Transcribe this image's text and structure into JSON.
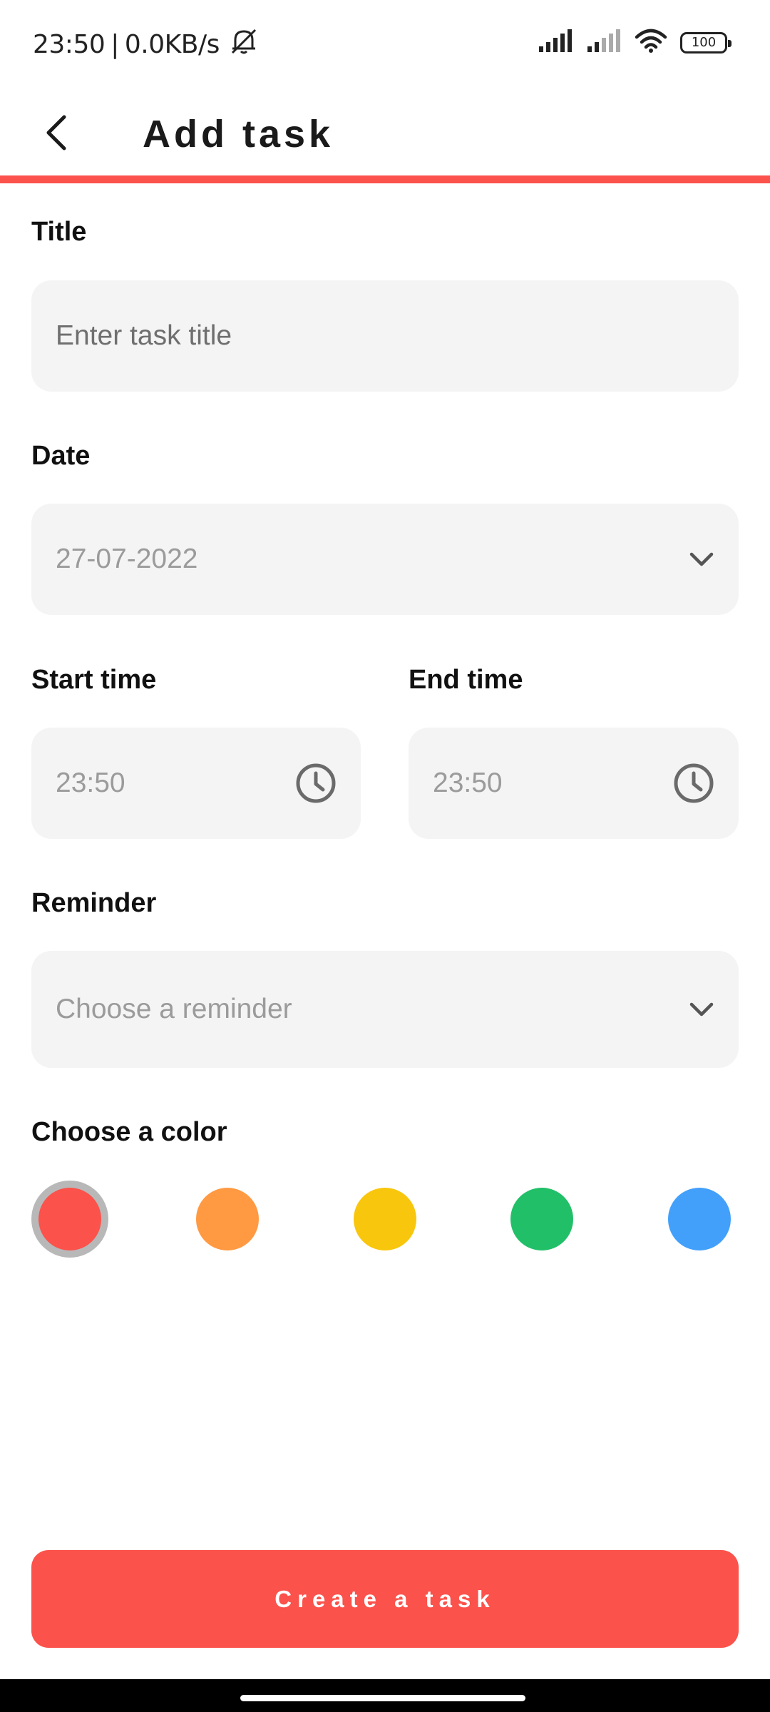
{
  "status_bar": {
    "time": "23:50",
    "separator": "|",
    "network_speed": "0.0KB/s",
    "battery": "100",
    "icons": [
      "bell-off-icon",
      "signal-icon",
      "signal-weak-icon",
      "wifi-icon",
      "battery-icon"
    ]
  },
  "header": {
    "back_icon": "chevron-left-icon",
    "title": "Add task"
  },
  "form": {
    "title_label": "Title",
    "title_placeholder": "Enter task title",
    "date_label": "Date",
    "date_value": "27-07-2022",
    "start_time_label": "Start time",
    "start_time_value": "23:50",
    "end_time_label": "End time",
    "end_time_value": "23:50",
    "reminder_label": "Reminder",
    "reminder_placeholder": "Choose a reminder",
    "color_label": "Choose a color",
    "colors": [
      {
        "name": "red",
        "hex": "#fb524b",
        "selected": true
      },
      {
        "name": "orange",
        "hex": "#ff9a43",
        "selected": false
      },
      {
        "name": "yellow",
        "hex": "#f8c60c",
        "selected": false
      },
      {
        "name": "green",
        "hex": "#21c068",
        "selected": false
      },
      {
        "name": "blue",
        "hex": "#42a0fb",
        "selected": false
      }
    ]
  },
  "actions": {
    "create_label": "Create a task"
  },
  "theme": {
    "accent": "#fb524b",
    "field_bg": "#f4f4f4"
  }
}
